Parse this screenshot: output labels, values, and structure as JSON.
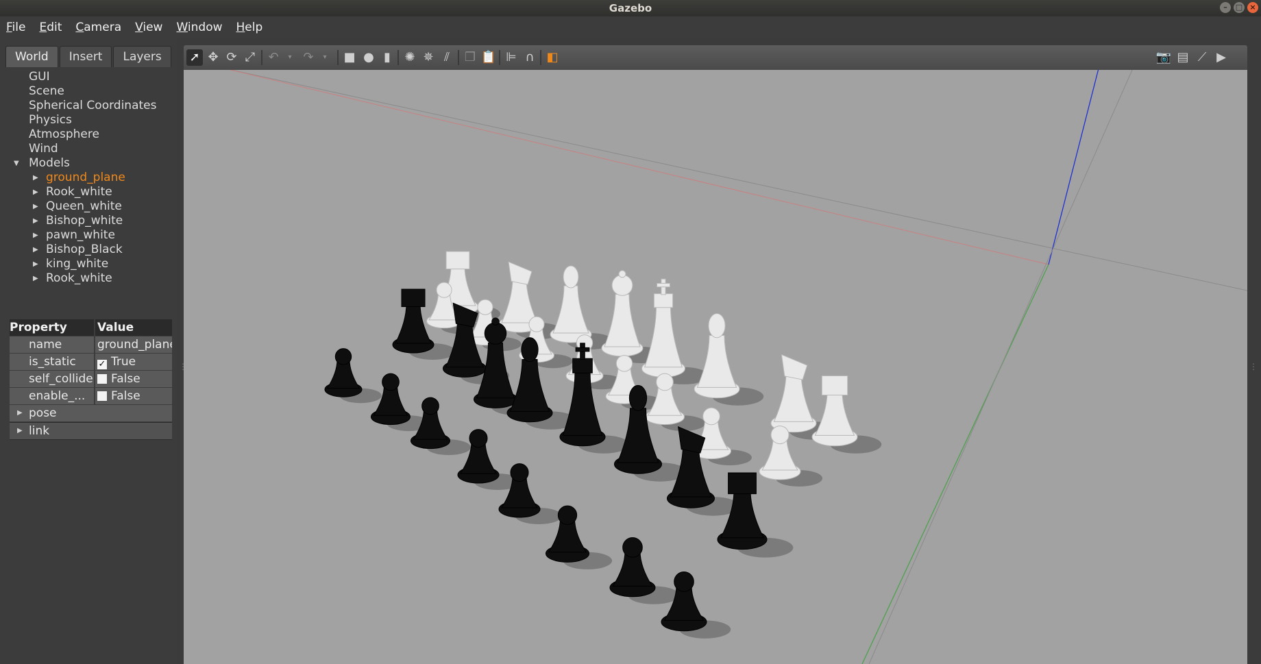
{
  "window": {
    "title": "Gazebo"
  },
  "menubar": [
    "File",
    "Edit",
    "Camera",
    "View",
    "Window",
    "Help"
  ],
  "left_panel": {
    "tabs": [
      "World",
      "Insert",
      "Layers"
    ],
    "active_tab": "World",
    "tree": {
      "top_items": [
        "GUI",
        "Scene",
        "Spherical Coordinates",
        "Physics",
        "Atmosphere",
        "Wind"
      ],
      "models_label": "Models",
      "models": [
        "ground_plane",
        "Rook_white",
        "Queen_white",
        "Bishop_white",
        "pawn_white",
        "Bishop_Black",
        "king_white",
        "Rook_white"
      ],
      "selected": "ground_plane"
    },
    "properties": {
      "header": {
        "property": "Property",
        "value": "Value"
      },
      "rows": [
        {
          "key": "name",
          "value": "ground_plane",
          "type": "text"
        },
        {
          "key": "is_static",
          "value": "True",
          "type": "checkbox",
          "checked": true
        },
        {
          "key": "self_collide",
          "value": "False",
          "type": "checkbox",
          "checked": false
        },
        {
          "key": "enable_...",
          "value": "False",
          "type": "checkbox",
          "checked": false
        }
      ],
      "groups": [
        "pose",
        "link"
      ]
    }
  },
  "toolbar": {
    "left_tools": [
      "select-mode",
      "translate-mode",
      "rotate-mode",
      "scale-mode",
      "undo",
      "undo-history",
      "redo",
      "redo-history",
      "box-shape",
      "sphere-shape",
      "cylinder-shape",
      "point-light",
      "spot-light",
      "directional-light",
      "copy",
      "paste",
      "align",
      "snap",
      "view-angle"
    ],
    "right_tools": [
      "screenshot",
      "log",
      "plot",
      "record-video"
    ],
    "active_tool": "select-mode"
  },
  "scene": {
    "background_color": "#a2a2a2",
    "selected_color": "#f0891c"
  }
}
